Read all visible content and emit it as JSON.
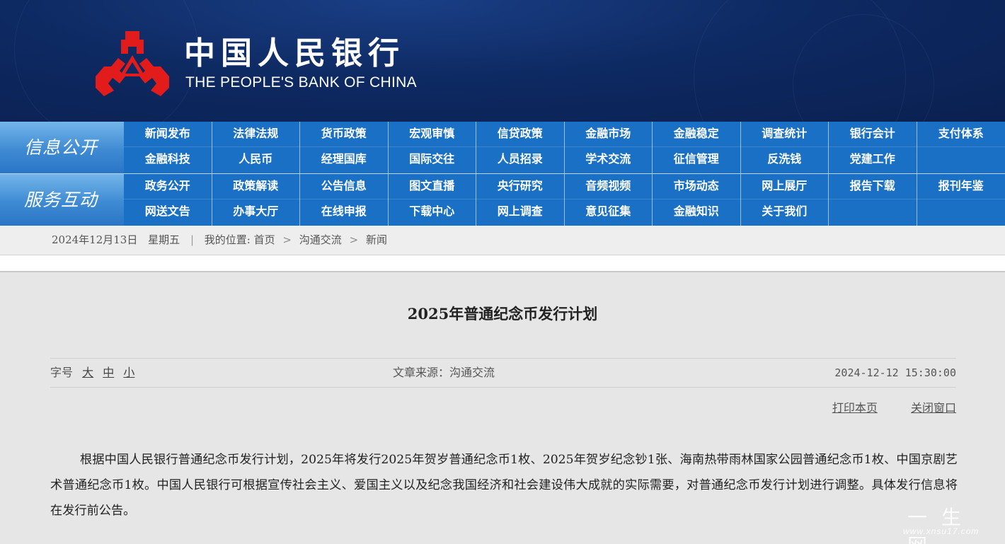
{
  "header": {
    "cn_name": "中国人民银行",
    "en_name": "THE PEOPLE'S BANK OF CHINA",
    "logo_color": "#e21b1b"
  },
  "nav": [
    {
      "label": "信息公开",
      "rows": [
        [
          "新闻发布",
          "法律法规",
          "货币政策",
          "宏观审慎",
          "信贷政策",
          "金融市场",
          "金融稳定",
          "调查统计",
          "银行会计",
          "支付体系"
        ],
        [
          "金融科技",
          "人民币",
          "经理国库",
          "国际交往",
          "人员招录",
          "学术交流",
          "征信管理",
          "反洗钱",
          "党建工作",
          ""
        ]
      ]
    },
    {
      "label": "服务互动",
      "rows": [
        [
          "政务公开",
          "政策解读",
          "公告信息",
          "图文直播",
          "央行研究",
          "音频视频",
          "市场动态",
          "网上展厅",
          "报告下载",
          "报刊年鉴"
        ],
        [
          "网送文告",
          "办事大厅",
          "在线申报",
          "下载中心",
          "网上调查",
          "意见征集",
          "金融知识",
          "关于我们",
          "",
          ""
        ]
      ]
    }
  ],
  "breadcrumb": {
    "date": "2024年12月13日",
    "weekday": "星期五",
    "location_label": "我的位置:",
    "items": [
      "首页",
      "沟通交流",
      "新闻"
    ]
  },
  "article": {
    "title": "2025年普通纪念币发行计划",
    "font_size_label": "字号",
    "font_sizes": [
      "大",
      "中",
      "小"
    ],
    "source": "文章来源：沟通交流",
    "datetime": "2024-12-12  15:30:00",
    "print_label": "打印本页",
    "close_label": "关闭窗口",
    "body": "根据中国人民银行普通纪念币发行计划，2025年将发行2025年贺岁普通纪念币1枚、2025年贺岁纪念钞1张、海南热带雨林国家公园普通纪念币1枚、中国京剧艺术普通纪念币1枚。中国人民银行可根据宣传社会主义、爱国主义以及纪念我国经济和社会建设伟大成就的实际需要，对普通纪念币发行计划进行调整。具体发行信息将在发行前公告。"
  },
  "watermark": {
    "cn": "一生网",
    "url": "www.xnsu17.com"
  }
}
